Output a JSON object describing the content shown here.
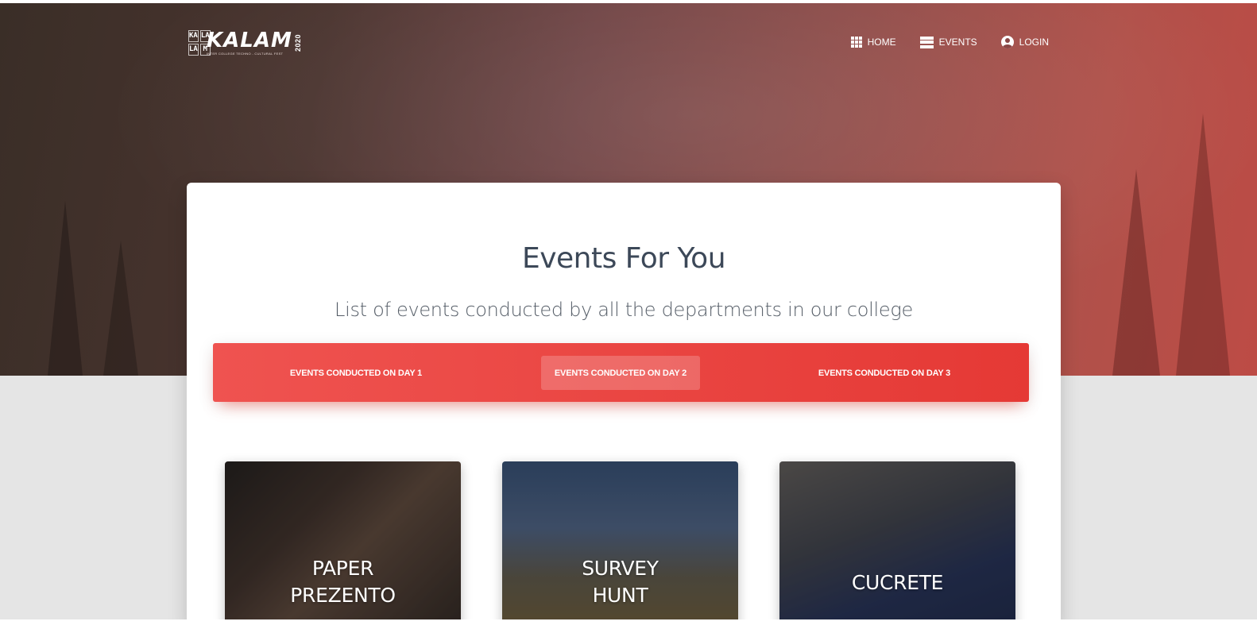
{
  "brand": {
    "mono_letters": [
      "KA",
      "LA",
      "LA",
      "M"
    ],
    "name": "KALAM",
    "tagline": "INTER COLLEGE TECHNO - CULTURAL FEST",
    "year": "2020"
  },
  "nav": {
    "items": [
      {
        "label": "HOME",
        "icon": "apps-icon"
      },
      {
        "label": "EVENTS",
        "icon": "view-day-icon"
      },
      {
        "label": "LOGIN",
        "icon": "account-circle-icon"
      }
    ]
  },
  "main": {
    "title": "Events For You",
    "subtitle": "List of events conducted by all the departments in our college",
    "tabs": [
      {
        "label": "EVENTS CONDUCTED ON DAY 1",
        "active": false
      },
      {
        "label": "EVENTS CONDUCTED ON DAY 2",
        "active": true
      },
      {
        "label": "EVENTS CONDUCTED ON DAY 3",
        "active": false
      }
    ],
    "events": [
      {
        "line1": "PAPER",
        "line2": "PREZENTO"
      },
      {
        "line1": "SURVEY",
        "line2": "HUNT"
      },
      {
        "line1": "CUCRETE",
        "line2": ""
      }
    ]
  },
  "colors": {
    "tab_bar": "#e53935",
    "hero_left": "#3a2e27",
    "hero_right": "#bd4b45"
  }
}
